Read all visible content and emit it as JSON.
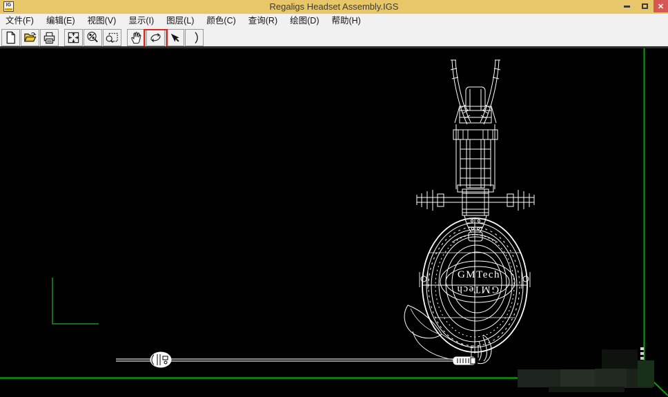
{
  "window": {
    "title": "Regaligs Headset Assembly.IGS",
    "app_icon_text": "IG",
    "close_glyph": "✕"
  },
  "menu": {
    "items": [
      {
        "id": "file",
        "label": "文件(F)"
      },
      {
        "id": "edit",
        "label": "编辑(E)"
      },
      {
        "id": "view",
        "label": "视图(V)"
      },
      {
        "id": "display",
        "label": "显示(I)"
      },
      {
        "id": "layer",
        "label": "图层(L)"
      },
      {
        "id": "color",
        "label": "颜色(C)"
      },
      {
        "id": "query",
        "label": "查询(R)"
      },
      {
        "id": "draw",
        "label": "绘图(D)"
      },
      {
        "id": "help",
        "label": "帮助(H)"
      }
    ]
  },
  "toolbar": {
    "buttons": [
      {
        "id": "new",
        "icon": "new-document-icon"
      },
      {
        "id": "open",
        "icon": "open-folder-icon"
      },
      {
        "id": "print",
        "icon": "print-icon"
      },
      {
        "id": "zoom-extents",
        "icon": "zoom-extents-icon"
      },
      {
        "id": "zoom-scale",
        "icon": "zoom-percent-icon"
      },
      {
        "id": "zoom-window",
        "icon": "zoom-window-icon"
      },
      {
        "id": "pan",
        "icon": "pan-hand-icon"
      },
      {
        "id": "rotate",
        "icon": "rotate-orbit-icon",
        "highlighted": true
      },
      {
        "id": "select",
        "icon": "select-arrow-icon"
      },
      {
        "id": "arc",
        "icon": "arc-icon"
      }
    ]
  },
  "canvas": {
    "cup_text": "GMTech",
    "cup_text_mirrored": "GMTech"
  },
  "colors": {
    "titlebar": "#e8c66a",
    "close_button": "#d85654",
    "chrome_bg": "#f1f1f1",
    "canvas_bg": "#000000",
    "wireframe": "#ffffff",
    "frame_green": "#0da20d",
    "axis_green": "#137113",
    "annotation_red": "#e12b20",
    "folder_yellow": "#e8c73c"
  }
}
